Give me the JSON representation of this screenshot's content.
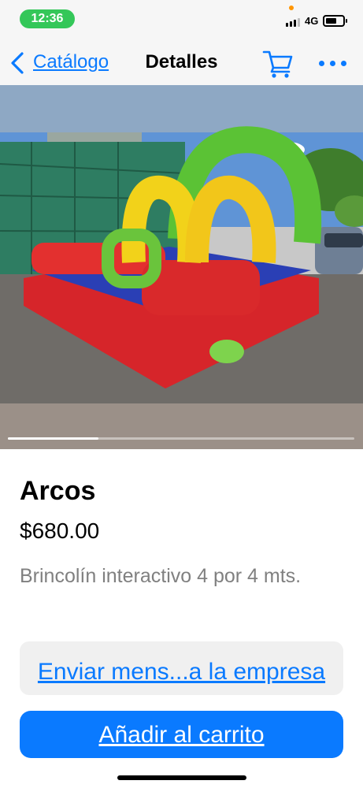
{
  "status_bar": {
    "time": "12:36",
    "network": "4G",
    "signal_bars": 3,
    "battery_level_percent": 55,
    "time_pill_color": "#34c759",
    "indicator_dot_color": "#ff9500"
  },
  "nav": {
    "back_label": "Catálogo",
    "title": "Detalles",
    "icons": [
      "chevron-left-icon",
      "cart-icon",
      "more-icon"
    ],
    "accent_color": "#0a7aff"
  },
  "gallery": {
    "image_description": "Brincolín inflable con arcos verdes y amarillos sobre base roja",
    "current_page": 1,
    "total_pages": 4
  },
  "product": {
    "name": "Arcos",
    "price": "$680.00",
    "description": "Brincolín interactivo 4 por 4 mts."
  },
  "actions": {
    "message_label": "Enviar mens...a la empresa",
    "add_to_cart_label": "Añadir al carrito"
  }
}
